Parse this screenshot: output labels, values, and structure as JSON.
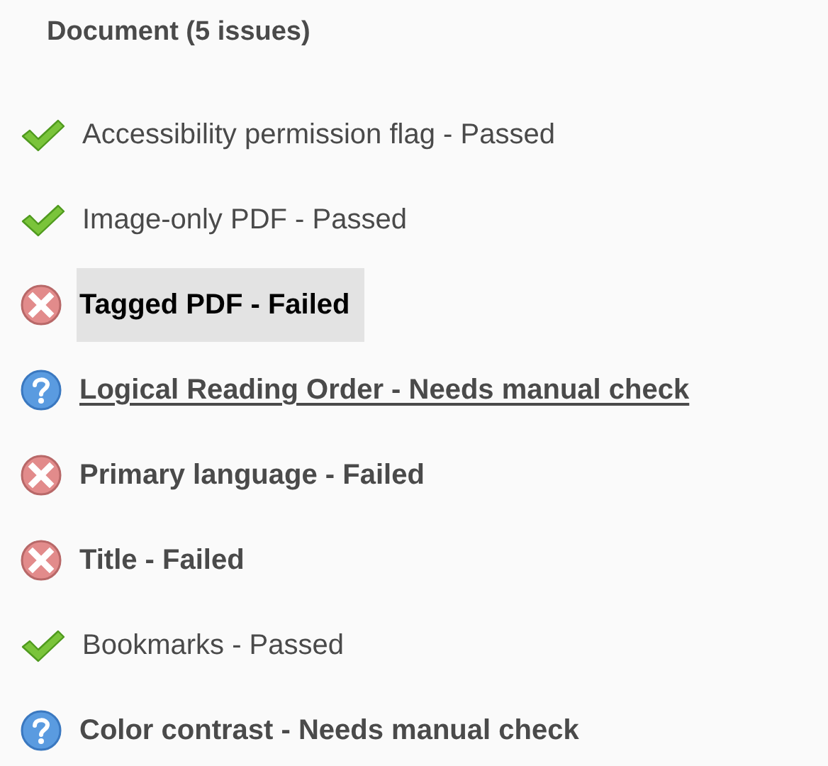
{
  "section": {
    "title": "Document (5 issues)"
  },
  "checks": [
    {
      "kind": "passed",
      "label": "Accessibility permission flag - Passed",
      "selected": false,
      "underlined": false
    },
    {
      "kind": "passed",
      "label": "Image-only PDF - Passed",
      "selected": false,
      "underlined": false
    },
    {
      "kind": "failed",
      "label": "Tagged PDF - Failed",
      "selected": true,
      "underlined": false
    },
    {
      "kind": "manual",
      "label": "Logical Reading Order - Needs manual check",
      "selected": false,
      "underlined": true
    },
    {
      "kind": "failed",
      "label": "Primary language - Failed",
      "selected": false,
      "underlined": false
    },
    {
      "kind": "failed",
      "label": "Title - Failed",
      "selected": false,
      "underlined": false
    },
    {
      "kind": "passed",
      "label": "Bookmarks - Passed",
      "selected": false,
      "underlined": false
    },
    {
      "kind": "manual",
      "label": "Color contrast - Needs manual check",
      "selected": false,
      "underlined": false
    }
  ]
}
